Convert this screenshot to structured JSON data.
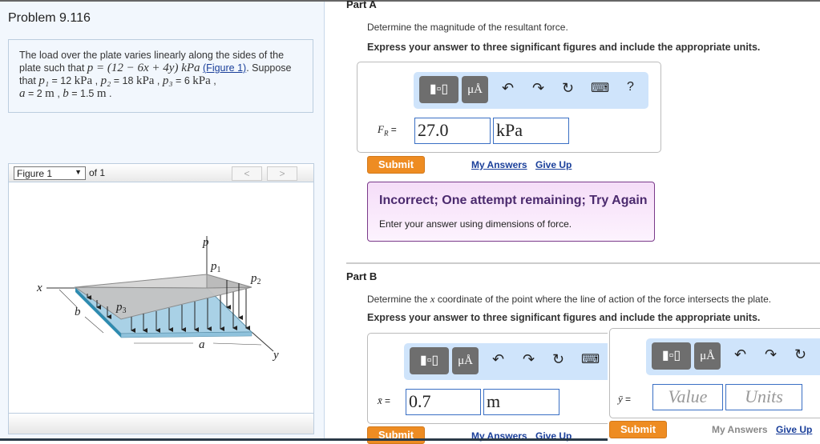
{
  "problem": {
    "title": "Problem 9.116",
    "s1": "The load over the plate varies linearly along the sides of the plate such that ",
    "eq": "p = (12 − 6x + 4y) kPa",
    "fig_link": "(Figure 1)",
    "s2": ". Suppose that ",
    "p1": "p₁",
    "p1v": " = 12 ",
    "u_kpa": "kPa",
    "p2": "p₂",
    "p2v": " = 18 ",
    "p3": "p₃",
    "p3v": " = 6 ",
    "a": "a",
    "av": " = 2 ",
    "u_m": "m",
    "b": "b",
    "bv": " = 1.5 ",
    "sep": " , ",
    "end": " ."
  },
  "figure": {
    "select": "Figure 1",
    "of": "of 1",
    "prev": "<",
    "next": ">",
    "labels": {
      "p": "p",
      "p1": "p",
      "p1s": "1",
      "p2": "p",
      "p2s": "2",
      "p3": "p",
      "p3s": "3",
      "x": "x",
      "y": "y",
      "a": "a",
      "b": "b"
    }
  },
  "toolbar": {
    "templates": "templates-icon",
    "units": "μÅ",
    "undo": "undo-icon",
    "redo": "redo-icon",
    "reset": "reset-icon",
    "keyboard": "keyboard-icon",
    "help": "?"
  },
  "partA": {
    "title": "Part A",
    "question": "Determine the magnitude of the resultant force.",
    "instruction": "Express your answer to three significant figures and include the appropriate units.",
    "var": "F",
    "var_sub": "R",
    "eq": "=",
    "value": "27.0",
    "units": "kPa",
    "submit": "Submit",
    "my_answers": "My Answers",
    "give_up": "Give Up",
    "feedback_title": "Incorrect; One attempt remaining; Try Again",
    "feedback_text": "Enter your answer using dimensions of force."
  },
  "partB": {
    "title": "Part B",
    "question_pre": "Determine the ",
    "question_var": "x",
    "question_post": " coordinate of the point where the line of action of the force intersects the plate.",
    "instruction": "Express your answer to three significant figures and include the appropriate units.",
    "var": "x̄",
    "eq": "=",
    "value": "0.7",
    "units": "m",
    "submit": "Submit",
    "my_answers": "My Answers",
    "give_up": "Give Up"
  },
  "partC": {
    "var": "ȳ",
    "eq": "=",
    "value_placeholder": "Value",
    "units_placeholder": "Units",
    "submit": "Submit",
    "my_answers": "My Answers",
    "give_up": "Give Up"
  }
}
